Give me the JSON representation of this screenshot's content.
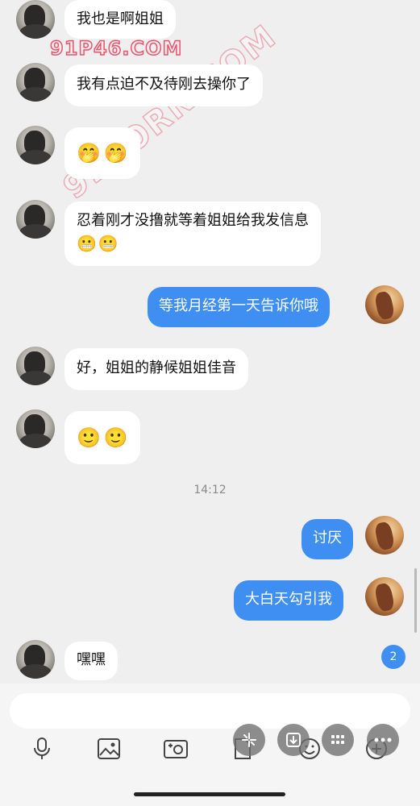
{
  "watermark": {
    "top_text": "91P46.COM",
    "diagonal_text": "91PORN.COM"
  },
  "messages": [
    {
      "side": "left",
      "text": "我也是啊姐姐"
    },
    {
      "side": "left",
      "text": "我有点迫不及待刚去操你了"
    },
    {
      "side": "left",
      "emojis": [
        "🤭",
        "🤭"
      ]
    },
    {
      "side": "left",
      "text": "忍着刚才没撸就等着姐姐给我发信息",
      "emojis": [
        "😬",
        "😬"
      ]
    },
    {
      "side": "right",
      "text": "等我月经第一天告诉你哦"
    },
    {
      "side": "left",
      "text": "好，姐姐的静候姐姐佳音"
    },
    {
      "side": "left",
      "emojis": [
        "🙂",
        "🙂"
      ]
    },
    {
      "side": "right",
      "text": "讨厌"
    },
    {
      "side": "right",
      "text": "大白天勾引我"
    },
    {
      "side": "left",
      "text": "嘿嘿"
    }
  ],
  "timestamp": "14:12",
  "unread_count": "2",
  "colors": {
    "outgoing_bubble": "#3e8ff1",
    "incoming_bubble": "#ffffff",
    "background": "#efefef"
  },
  "toolbar_icons": [
    "microphone-icon",
    "image-icon",
    "camera-icon",
    "file-icon",
    "emoji-icon",
    "plus-icon"
  ],
  "floating_buttons": [
    "sparkle-icon",
    "download-icon",
    "grid-icon",
    "more-icon"
  ]
}
